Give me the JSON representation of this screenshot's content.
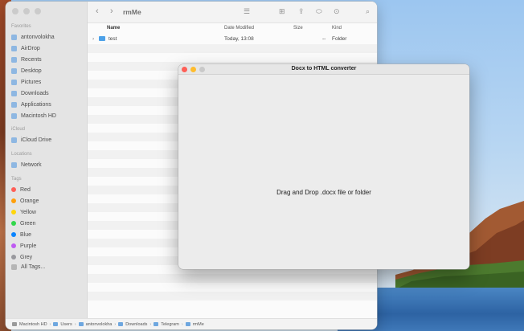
{
  "finder": {
    "title": "rmMe",
    "sidebar": {
      "favorites_heading": "Favorites",
      "favorites": [
        {
          "label": "antonvolokha",
          "icon": "home-icon"
        },
        {
          "label": "AirDrop",
          "icon": "airdrop-icon"
        },
        {
          "label": "Recents",
          "icon": "clock-icon"
        },
        {
          "label": "Desktop",
          "icon": "desktop-icon"
        },
        {
          "label": "Pictures",
          "icon": "pictures-icon"
        },
        {
          "label": "Downloads",
          "icon": "downloads-icon"
        },
        {
          "label": "Applications",
          "icon": "applications-icon"
        },
        {
          "label": "Macintosh HD",
          "icon": "disk-icon"
        }
      ],
      "icloud_heading": "iCloud",
      "icloud": [
        {
          "label": "iCloud Drive",
          "icon": "cloud-icon"
        }
      ],
      "locations_heading": "Locations",
      "locations": [
        {
          "label": "Network",
          "icon": "network-icon"
        }
      ],
      "tags_heading": "Tags",
      "tags": [
        {
          "label": "Red",
          "color": "#ff5f57"
        },
        {
          "label": "Orange",
          "color": "#ff9f0a"
        },
        {
          "label": "Yellow",
          "color": "#ffd60a"
        },
        {
          "label": "Green",
          "color": "#32d74b"
        },
        {
          "label": "Blue",
          "color": "#0a84ff"
        },
        {
          "label": "Purple",
          "color": "#bf5af2"
        },
        {
          "label": "Grey",
          "color": "#98989d"
        }
      ],
      "all_tags": "All Tags..."
    },
    "columns": {
      "name": "Name",
      "date": "Date Modified",
      "size": "Size",
      "kind": "Kind"
    },
    "files": [
      {
        "name": "test",
        "date": "Today, 13:08",
        "size": "--",
        "kind": "Folder"
      }
    ],
    "path": [
      "Macintosh HD",
      "Users",
      "antonvolokha",
      "Downloads",
      "Telegram",
      "rmMe"
    ]
  },
  "converter": {
    "title": "Docx to HTML converter",
    "drop_text": "Drag and Drop .docx file or folder"
  }
}
